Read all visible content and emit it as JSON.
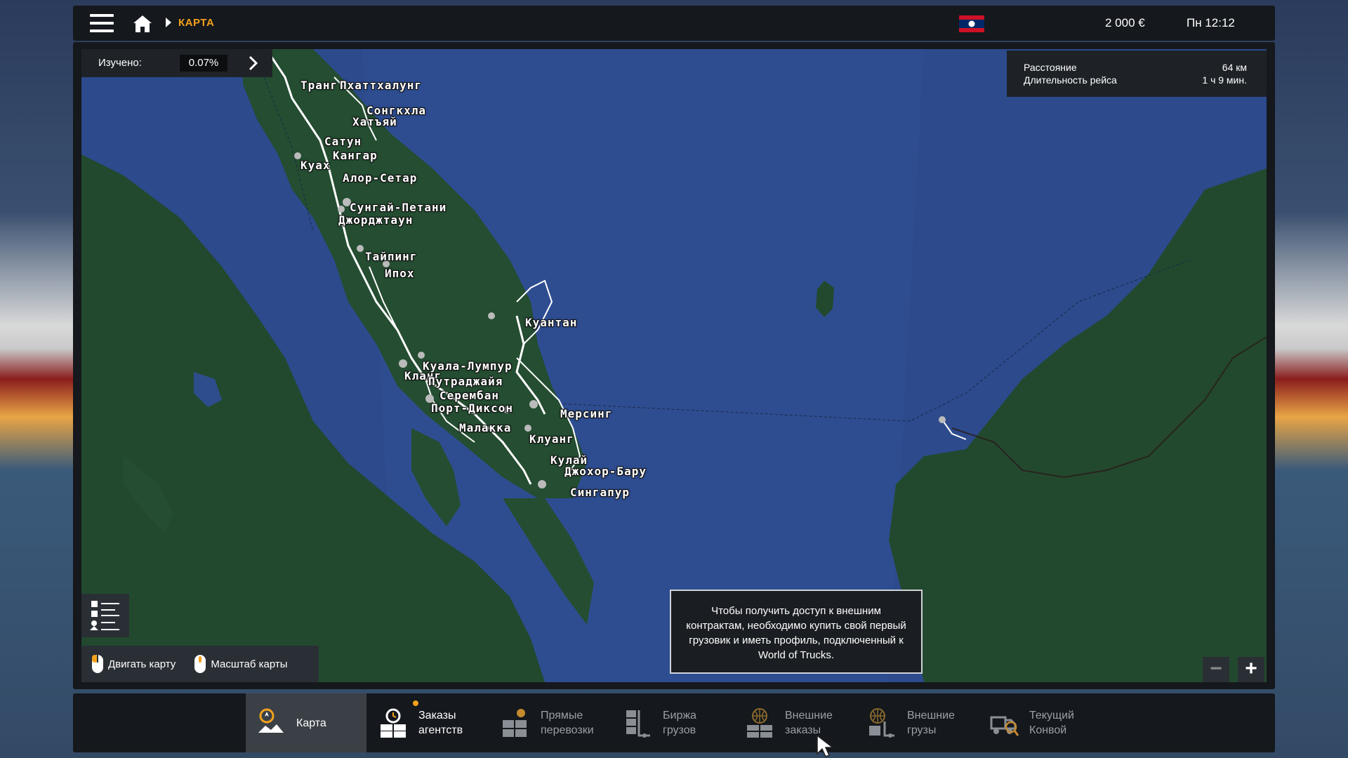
{
  "topbar": {
    "breadcrumb": "КАРТА",
    "money": "2 000 €",
    "time": "Пн 12:12",
    "icons": [
      "menu-icon",
      "home-icon",
      "flag-icon"
    ]
  },
  "map": {
    "explored_label": "Изучено:",
    "explored_value": "0.07%",
    "route": {
      "distance_label": "Расстояние",
      "distance_value": "64 км",
      "duration_label": "Длительность рейса",
      "duration_value": "1 ч 9 мин."
    },
    "cities": [
      "Транг",
      "Пхаттхалунг",
      "Сонгкхла",
      "Хатъяй",
      "Сатун",
      "Кангар",
      "Куах",
      "Алор-Сетар",
      "Сунгай-Петани",
      "Джорджтаун",
      "Тайпинг",
      "Ипох",
      "Куантан",
      "Куала-Лумпур",
      "Кланг",
      "Путраджайя",
      "Серембан",
      "Порт-Диксон",
      "Малакка",
      "Мерсинг",
      "Клуанг",
      "Кулай",
      "Джохор-Бару",
      "Сингапур"
    ],
    "hints": {
      "move": "Двигать карту",
      "zoom": "Масштаб карты"
    },
    "notice": "Чтобы получить доступ к внешним контрактам, необходимо купить свой первый грузовик и иметь профиль, подключенный к World of Trucks.",
    "zoom_out": "−",
    "zoom_in": "+",
    "colors": {
      "sea": "#2c4a8c",
      "land": "#22492e",
      "roads": "#ffffff"
    }
  },
  "nav": {
    "tabs": [
      {
        "line1": "Карта",
        "line2": "",
        "icon": "map-pin-icon"
      },
      {
        "line1": "Заказы",
        "line2": "агентств",
        "icon": "clock-boxes-icon"
      },
      {
        "line1": "Прямые",
        "line2": "перевозки",
        "icon": "boxes-person-icon"
      },
      {
        "line1": "Биржа",
        "line2": "грузов",
        "icon": "hand-truck-icon"
      },
      {
        "line1": "Внешние",
        "line2": "заказы",
        "icon": "globe-boxes-icon"
      },
      {
        "line1": "Внешние",
        "line2": "грузы",
        "icon": "globe-hand-truck-icon"
      },
      {
        "line1": "Текущий",
        "line2": "Конвой",
        "icon": "truck-search-icon"
      }
    ]
  }
}
